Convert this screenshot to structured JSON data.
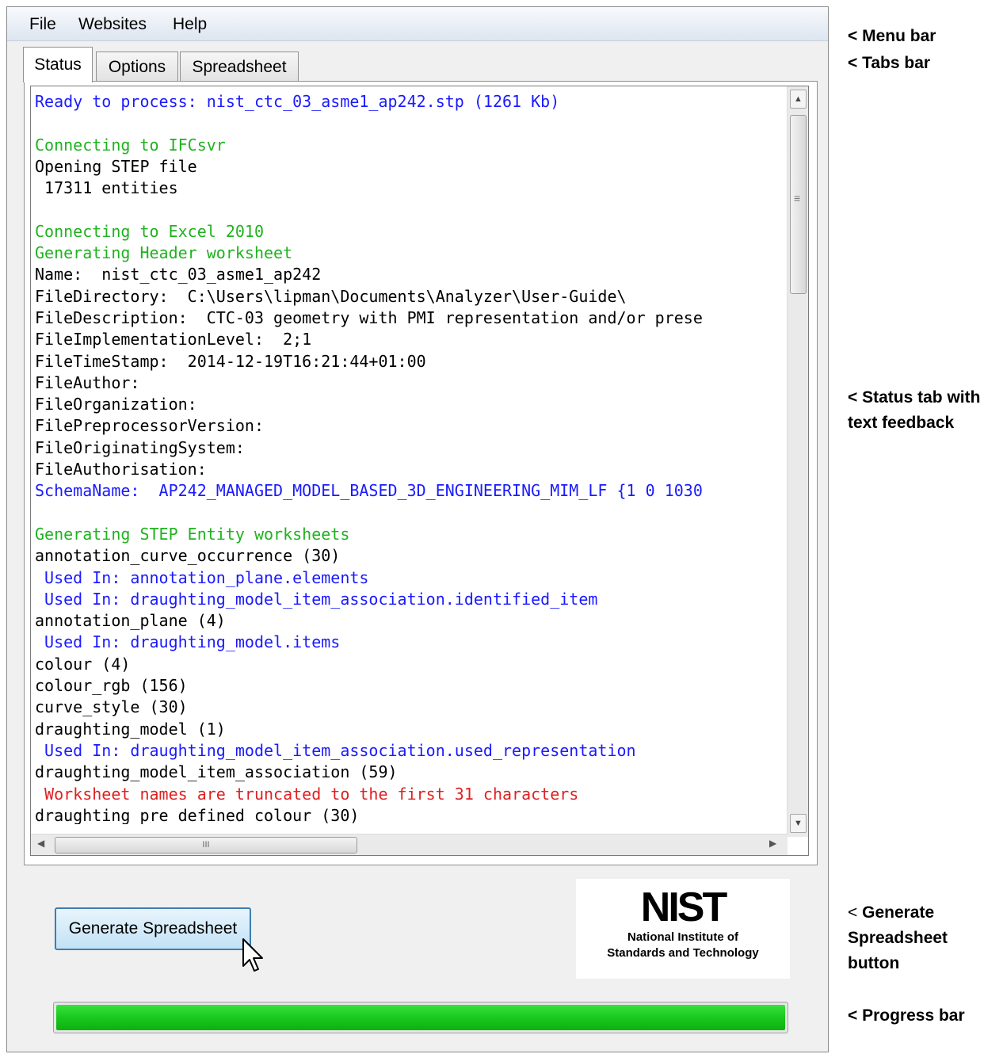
{
  "menu": {
    "items": [
      "File",
      "Websites",
      "Help"
    ]
  },
  "tabs": [
    "Status",
    "Options",
    "Spreadsheet"
  ],
  "status_lines": [
    {
      "text": "Ready to process: nist_ctc_03_asme1_ap242.stp (1261 Kb)",
      "color": "#1a1aff"
    },
    {
      "text": "",
      "color": "#000000"
    },
    {
      "text": "Connecting to IFCsvr",
      "color": "#1fb21f"
    },
    {
      "text": "Opening STEP file",
      "color": "#000000"
    },
    {
      "text": " 17311 entities",
      "color": "#000000"
    },
    {
      "text": "",
      "color": "#000000"
    },
    {
      "text": "Connecting to Excel 2010",
      "color": "#1fb21f"
    },
    {
      "text": "Generating Header worksheet",
      "color": "#1fb21f"
    },
    {
      "text": "Name:  nist_ctc_03_asme1_ap242",
      "color": "#000000"
    },
    {
      "text": "FileDirectory:  C:\\Users\\lipman\\Documents\\Analyzer\\User-Guide\\",
      "color": "#000000"
    },
    {
      "text": "FileDescription:  CTC-03 geometry with PMI representation and/or prese",
      "color": "#000000"
    },
    {
      "text": "FileImplementationLevel:  2;1",
      "color": "#000000"
    },
    {
      "text": "FileTimeStamp:  2014-12-19T16:21:44+01:00",
      "color": "#000000"
    },
    {
      "text": "FileAuthor:",
      "color": "#000000"
    },
    {
      "text": "FileOrganization:",
      "color": "#000000"
    },
    {
      "text": "FilePreprocessorVersion:",
      "color": "#000000"
    },
    {
      "text": "FileOriginatingSystem:",
      "color": "#000000"
    },
    {
      "text": "FileAuthorisation:",
      "color": "#000000"
    },
    {
      "text": "SchemaName:  AP242_MANAGED_MODEL_BASED_3D_ENGINEERING_MIM_LF {1 0 1030",
      "color": "#1a1aff"
    },
    {
      "text": "",
      "color": "#000000"
    },
    {
      "text": "Generating STEP Entity worksheets",
      "color": "#1fb21f"
    },
    {
      "text": "annotation_curve_occurrence (30)",
      "color": "#000000"
    },
    {
      "text": " Used In: annotation_plane.elements",
      "color": "#1a1aff"
    },
    {
      "text": " Used In: draughting_model_item_association.identified_item",
      "color": "#1a1aff"
    },
    {
      "text": "annotation_plane (4)",
      "color": "#000000"
    },
    {
      "text": " Used In: draughting_model.items",
      "color": "#1a1aff"
    },
    {
      "text": "colour (4)",
      "color": "#000000"
    },
    {
      "text": "colour_rgb (156)",
      "color": "#000000"
    },
    {
      "text": "curve_style (30)",
      "color": "#000000"
    },
    {
      "text": "draughting_model (1)",
      "color": "#000000"
    },
    {
      "text": " Used In: draughting_model_item_association.used_representation",
      "color": "#1a1aff"
    },
    {
      "text": "draughting_model_item_association (59)",
      "color": "#000000"
    },
    {
      "text": " Worksheet names are truncated to the first 31 characters",
      "color": "#e02020"
    },
    {
      "text": "draughting_pre_defined_colour (30)",
      "color": "#000000"
    }
  ],
  "scrollbar": {
    "thumb_grip": "≡",
    "h_thumb_grip": "III"
  },
  "generate_button": {
    "label": "Generate Spreadsheet"
  },
  "logo": {
    "mark": "NIST",
    "name_line1": "National Institute of",
    "name_line2": "Standards and Technology"
  },
  "progress": {
    "value": 1.0,
    "color": "#19c91c"
  },
  "annotations": {
    "menu_bar": "< Menu bar",
    "tabs_bar": "< Tabs bar",
    "status_tab_line1": "< Status tab with",
    "status_tab_line2": "text feedback",
    "generate_line1_prefix": "<",
    "generate_line1": "Generate",
    "generate_line2": "Spreadsheet",
    "generate_line3": "button",
    "progress_bar": "< Progress bar"
  }
}
